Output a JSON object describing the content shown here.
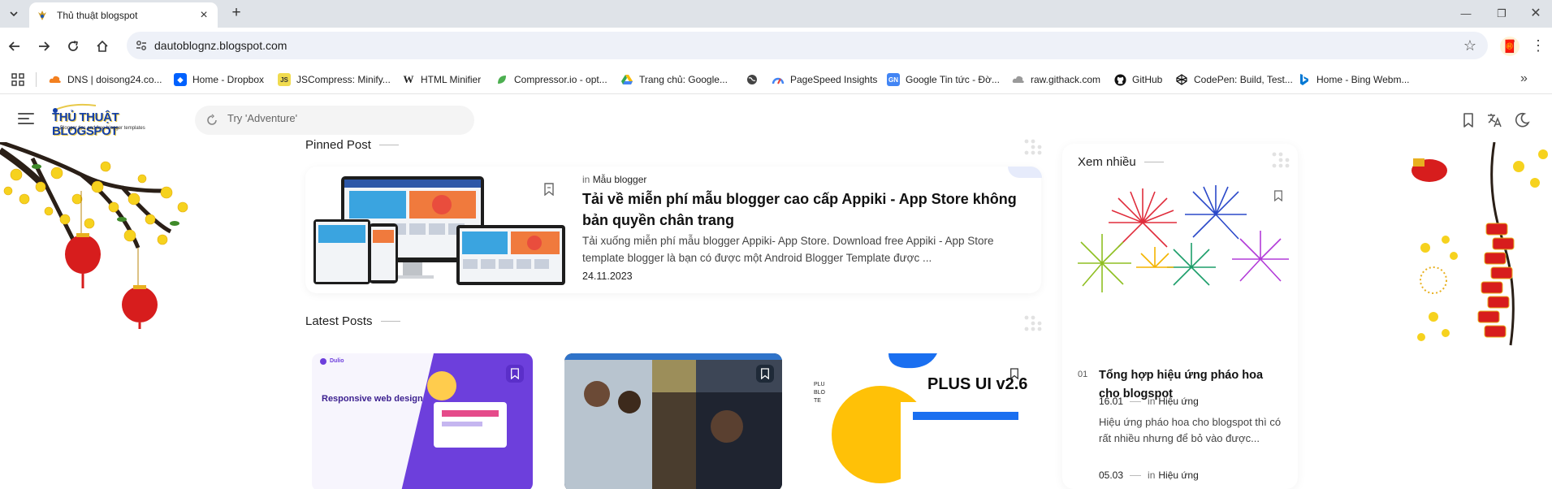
{
  "browser": {
    "tab_title": "Thủ thuật blogspot",
    "url": "dautoblognz.blogspot.com",
    "icons": {
      "back": "arrow-left-icon",
      "forward": "arrow-right-icon",
      "reload": "reload-icon",
      "home": "home-icon",
      "site_info": "tune-icon",
      "bookmark_star": "star-icon",
      "menu": "kebab-menu-icon"
    }
  },
  "bookmarks": [
    {
      "label": "DNS | doisong24.co...",
      "icon": "cloud-icon",
      "color": "#f38020"
    },
    {
      "label": "Home - Dropbox",
      "icon": "dropbox-icon",
      "color": "#0061fe"
    },
    {
      "label": "JSCompress: Minify...",
      "icon": "js-icon",
      "color": "#f0db4f"
    },
    {
      "label": "HTML Minifier",
      "icon": "w-icon",
      "color": "#222222"
    },
    {
      "label": "Compressor.io - opt...",
      "icon": "leaf-icon",
      "color": "#4caf50"
    },
    {
      "label": "Trang chủ: Google...",
      "icon": "google-drive-icon",
      "color": "#fbbc04"
    },
    {
      "label": "",
      "icon": "globe-icon",
      "color": "#444444"
    },
    {
      "label": "PageSpeed Insights",
      "icon": "pagespeed-icon",
      "color": "#4285f4"
    },
    {
      "label": "Google Tin tức - Đờ...",
      "icon": "google-news-icon",
      "color": "#4285f4"
    },
    {
      "label": "raw.githack.com",
      "icon": "cloud-icon",
      "color": "#888888"
    },
    {
      "label": "GitHub",
      "icon": "github-icon",
      "color": "#111111"
    },
    {
      "label": "CodePen: Build, Test...",
      "icon": "codepen-icon",
      "color": "#111111"
    },
    {
      "label": "Home - Bing Webm...",
      "icon": "bing-icon",
      "color": "#0078d4"
    }
  ],
  "site": {
    "logo_text": "THỦ THUẬT BLOGSPOT",
    "logo_tagline": "Blogger tips and free blogger templates",
    "search_placeholder": "Try 'Adventure'"
  },
  "pinned": {
    "section_title": "Pinned Post",
    "in_label": "in",
    "category": "Mẫu blogger",
    "title": "Tải về miễn phí mẫu blogger cao cấp Appiki - App Store không bản quyền chân trang",
    "excerpt": "Tải xuống miễn phí mẫu blogger Appiki- App Store. Download free Appiki - App Store template blogger là bạn có được một Android Blogger Template được ...",
    "date": "24.11.2023"
  },
  "latest": {
    "section_title": "Latest Posts",
    "cards": [
      {
        "text": "Responsive web design",
        "brand": "Dulio"
      },
      {
        "text": ""
      },
      {
        "text": "PLUS UI v2.6"
      }
    ]
  },
  "sidebar": {
    "section_title": "Xem nhiều",
    "item": {
      "date": "16.01",
      "in_label": "in",
      "category": "Hiệu ứng",
      "number": "01",
      "title": "Tổng hợp hiệu ứng pháo hoa cho blogspot",
      "excerpt": "Hiệu ứng pháo hoa cho blogspot thì có rất nhiều nhưng để bỏ vào được..."
    },
    "next_item": {
      "date": "05.03",
      "in_label": "in",
      "category": "Hiệu ứng"
    }
  }
}
